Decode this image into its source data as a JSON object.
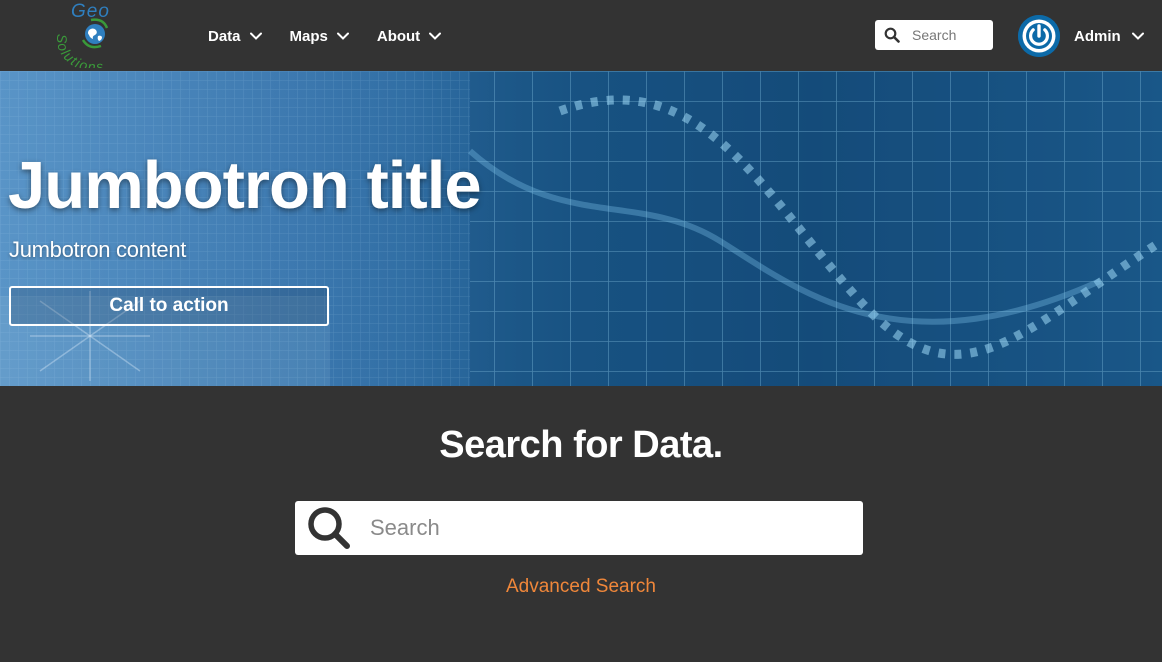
{
  "brand": {
    "logo_text_top": "Geo",
    "logo_text_bottom": "Solutions",
    "logo_icon": "globe-icon"
  },
  "nav": {
    "items": [
      {
        "label": "Data",
        "icon": "chevron-down-icon"
      },
      {
        "label": "Maps",
        "icon": "chevron-down-icon"
      },
      {
        "label": "About",
        "icon": "chevron-down-icon"
      }
    ],
    "search": {
      "placeholder": "Search",
      "value": "",
      "icon": "search-icon"
    },
    "user": {
      "name": "Admin",
      "avatar_icon": "power-icon"
    }
  },
  "jumbotron": {
    "title": "Jumbotron title",
    "content": "Jumbotron content",
    "cta_label": "Call to action"
  },
  "search_section": {
    "title": "Search for Data.",
    "placeholder": "Search",
    "value": "",
    "advanced_link": "Advanced Search"
  },
  "colors": {
    "background": "#333333",
    "accent_link": "#f0873a",
    "avatar_blue": "#0c6aa8",
    "logo_blue": "#2f7fbf",
    "logo_green": "#3a9a3a"
  }
}
